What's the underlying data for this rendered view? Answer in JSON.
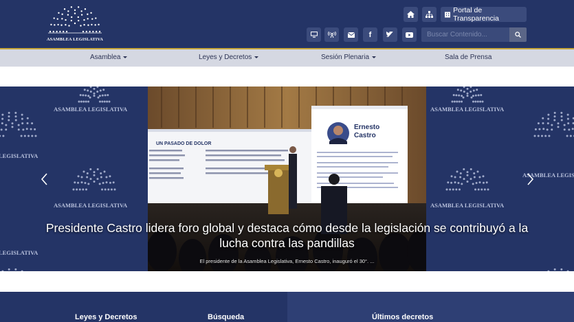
{
  "header": {
    "logo_text": "ASAMBLEA LEGISLATIVA",
    "top_buttons": [
      {
        "icon": "home-icon"
      },
      {
        "icon": "sitemap-icon"
      },
      {
        "icon": "building-icon",
        "label": "Portal de Transparencia"
      }
    ],
    "social_buttons": [
      {
        "icon": "monitor-icon"
      },
      {
        "icon": "broadcast-icon"
      },
      {
        "icon": "envelope-icon"
      },
      {
        "icon": "facebook-icon"
      },
      {
        "icon": "twitter-icon"
      },
      {
        "icon": "youtube-icon"
      }
    ],
    "search": {
      "placeholder": "Buscar Contenido..."
    }
  },
  "nav": {
    "items": [
      {
        "label": "Asamblea",
        "dropdown": true
      },
      {
        "label": "Leyes y Decretos",
        "dropdown": true
      },
      {
        "label": "Sesión Plenaria",
        "dropdown": true
      },
      {
        "label": "Sala de Prensa",
        "dropdown": false
      }
    ]
  },
  "carousel": {
    "side_label": "ASAMBLEA LEGISLATIVA",
    "side_label_partial": "LEGISLATIVA",
    "side_label_partial_right": "ASAMBLEA LEGISLATIVA",
    "slide": {
      "title_line1": "Presidente Castro lidera foro global y destaca cómo desde la legislación se contribuyó a la",
      "title_line2": "lucha contra las pandillas",
      "subtitle": "El presidente de la Asamblea Legislativa, Ernesto Castro, inauguró el  30°. ...",
      "screen_left_title": "UN PASADO DE DOLOR",
      "screen_right_name_1": "Ernesto",
      "screen_right_name_2": "Castro"
    }
  },
  "bottom": {
    "sections": [
      "Leyes y Decretos",
      "Búsqueda",
      "Últimos decretos"
    ]
  },
  "colors": {
    "header_bg": "#243466",
    "nav_bg": "#d5d8e2",
    "accent_gold": "#c9a83a"
  }
}
